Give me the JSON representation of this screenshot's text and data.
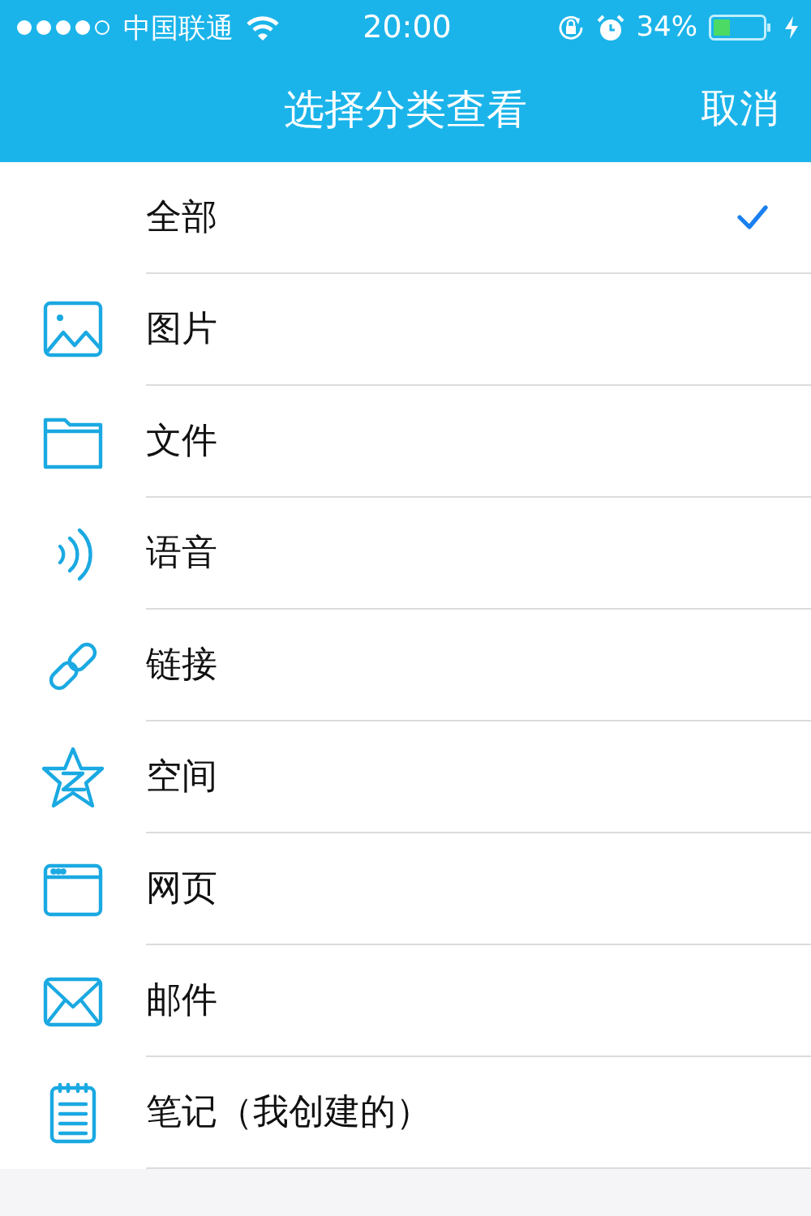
{
  "status_bar": {
    "carrier": "中国联通",
    "time": "20:00",
    "battery": "34%"
  },
  "nav": {
    "title": "选择分类查看",
    "cancel": "取消"
  },
  "items": [
    {
      "label": "全部",
      "kind": "all",
      "selected": true
    },
    {
      "label": "图片",
      "kind": "image",
      "selected": false
    },
    {
      "label": "文件",
      "kind": "folder",
      "selected": false
    },
    {
      "label": "语音",
      "kind": "voice",
      "selected": false
    },
    {
      "label": "链接",
      "kind": "link",
      "selected": false
    },
    {
      "label": "空间",
      "kind": "star",
      "selected": false
    },
    {
      "label": "网页",
      "kind": "webpage",
      "selected": false
    },
    {
      "label": "邮件",
      "kind": "mail",
      "selected": false
    },
    {
      "label": "笔记（我创建的）",
      "kind": "note",
      "selected": false
    }
  ]
}
